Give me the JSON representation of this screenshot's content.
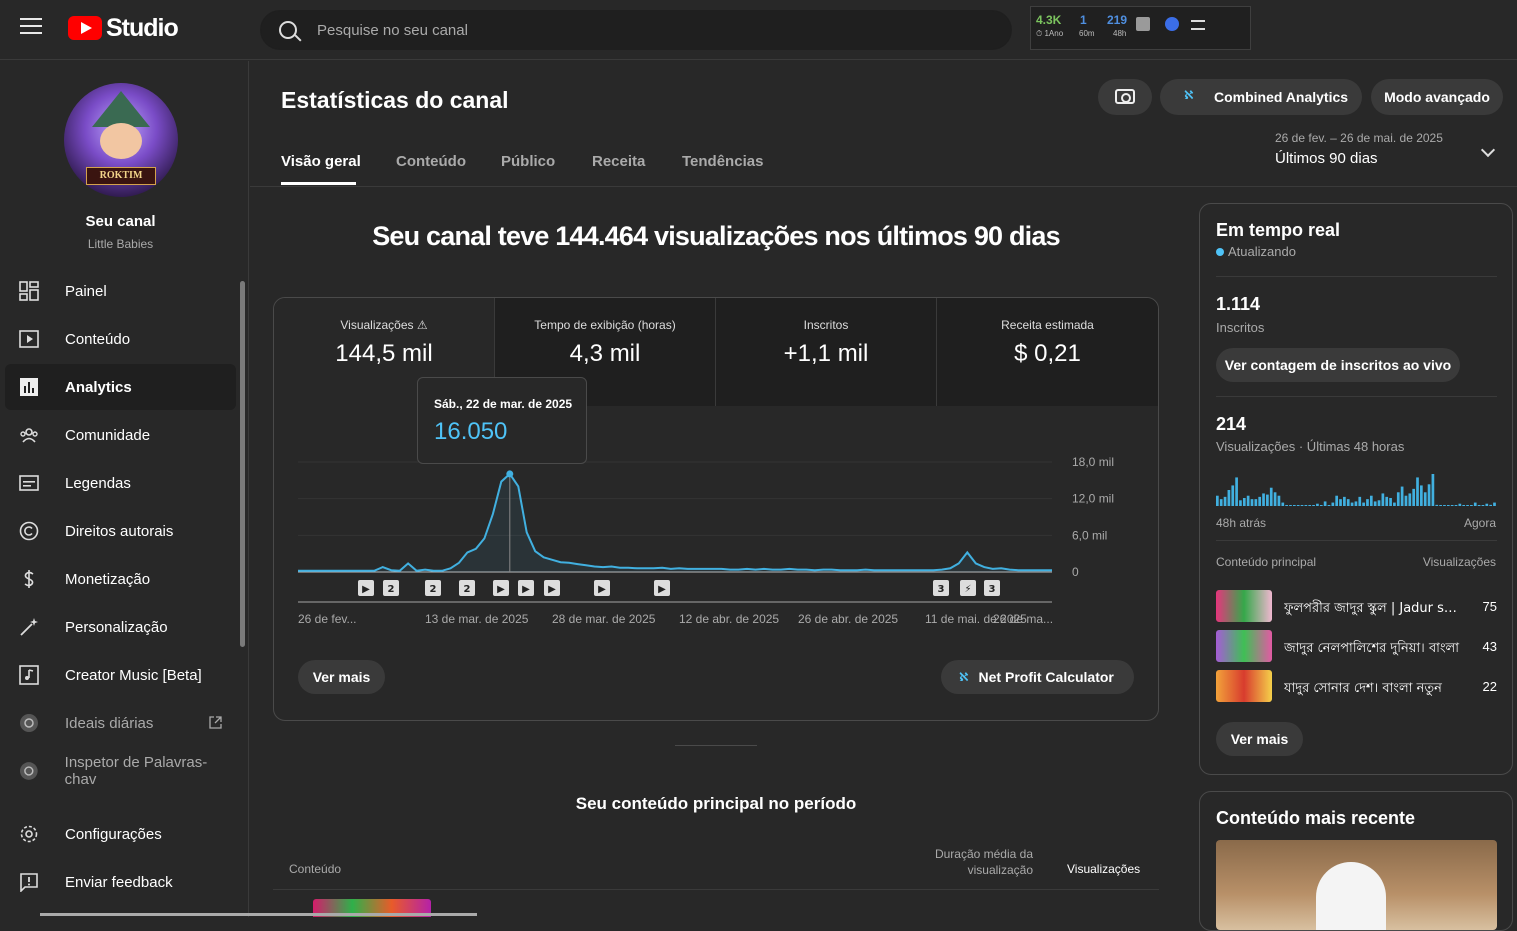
{
  "topbar": {
    "logo_text": "Studio",
    "search_placeholder": "Pesquise no seu canal",
    "ext_stats": [
      {
        "value": "4.3K",
        "sub": "⏱ 1Ano",
        "color": "#7cc45f"
      },
      {
        "value": "1",
        "sub": "60m",
        "color": "#4f8fe0"
      },
      {
        "value": "219",
        "sub": "48h",
        "color": "#4f8fe0"
      }
    ]
  },
  "sidebar": {
    "channel_banner": "ROKTIM",
    "channel_name": "Seu canal",
    "channel_sub": "Little Babies",
    "items": [
      {
        "label": "Painel",
        "icon": "dashboard-icon"
      },
      {
        "label": "Conteúdo",
        "icon": "content-icon"
      },
      {
        "label": "Analytics",
        "icon": "analytics-icon"
      },
      {
        "label": "Comunidade",
        "icon": "community-icon"
      },
      {
        "label": "Legendas",
        "icon": "subtitles-icon"
      },
      {
        "label": "Direitos autorais",
        "icon": "copyright-icon"
      },
      {
        "label": "Monetização",
        "icon": "dollar-icon"
      },
      {
        "label": "Personalização",
        "icon": "magic-wand-icon"
      },
      {
        "label": "Creator Music [Beta]",
        "icon": "music-icon"
      },
      {
        "label": "Ideais diárias",
        "icon": "vidiq-icon"
      },
      {
        "label": "Inspetor de Palavras-chav",
        "icon": "vidiq-icon"
      },
      {
        "label": "Configurações",
        "icon": "gear-icon"
      },
      {
        "label": "Enviar feedback",
        "icon": "feedback-icon"
      }
    ]
  },
  "header": {
    "title": "Estatísticas do canal",
    "combined_analytics": "Combined Analytics",
    "advanced_mode": "Modo avançado",
    "date_range": "26 de fev. – 26 de mai. de 2025",
    "date_label": "Últimos 90 dias",
    "tabs": [
      "Visão geral",
      "Conteúdo",
      "Público",
      "Receita",
      "Tendências"
    ]
  },
  "overview": {
    "headline": "Seu canal teve 144.464 visualizações nos últimos 90 dias",
    "metrics": [
      {
        "label": "Visualizações",
        "value": "144,5 mil"
      },
      {
        "label": "Tempo de exibição (horas)",
        "value": "4,3 mil"
      },
      {
        "label": "Inscritos",
        "value": "+1,1 mil"
      },
      {
        "label": "Receita estimada",
        "value": "$ 0,21"
      }
    ],
    "tooltip_date": "Sáb., 22 de mar. de 2025",
    "tooltip_value": "16.050",
    "see_more": "Ver mais",
    "net_profit": "Net Profit Calculator"
  },
  "chart_data": {
    "type": "line",
    "ylim": [
      0,
      18000
    ],
    "yticks": [
      0,
      6000,
      12000,
      18000
    ],
    "ytick_labels": [
      "0",
      "6,0 mil",
      "12,0 mil",
      "18,0 mil"
    ],
    "xtick_labels": [
      "26 de fev...",
      "13 de mar. de 2025",
      "28 de mar. de 2025",
      "12 de abr. de 2025",
      "26 de abr. de 2025",
      "11 de mai. de 2025",
      "26 de ma..."
    ],
    "x_days": 90,
    "values": [
      200,
      200,
      200,
      200,
      200,
      200,
      200,
      200,
      200,
      200,
      800,
      300,
      200,
      1400,
      200,
      400,
      200,
      200,
      600,
      1500,
      3200,
      3800,
      5500,
      9500,
      14800,
      16050,
      14000,
      6500,
      3400,
      2400,
      2000,
      1600,
      1500,
      1300,
      1100,
      900,
      800,
      900,
      700,
      700,
      600,
      600,
      600,
      700,
      500,
      600,
      500,
      500,
      500,
      500,
      500,
      400,
      400,
      500,
      400,
      500,
      400,
      400,
      500,
      400,
      400,
      300,
      400,
      400,
      300,
      300,
      300,
      400,
      300,
      300,
      300,
      300,
      300,
      300,
      300,
      300,
      400,
      600,
      1400,
      3200,
      1400,
      800,
      500,
      600,
      400,
      300,
      300,
      300,
      300,
      300
    ],
    "highlight_index": 25,
    "marker_labels": [
      "▶",
      "2",
      "2",
      "2",
      "▶",
      "▶",
      "▶",
      "▶",
      "▶",
      "3",
      "⚡",
      "3"
    ]
  },
  "top_content": {
    "title": "Seu conteúdo principal no período",
    "col_content": "Conteúdo",
    "col_duration": "Duração média da visualização",
    "col_views": "Visualizações"
  },
  "realtime": {
    "title": "Em tempo real",
    "updating": "Atualizando",
    "subs_value": "1.114",
    "subs_label": "Inscritos",
    "live_button": "Ver contagem de inscritos ao vivo",
    "views_value": "214",
    "views_label": "Visualizações · Últimas 48 horas",
    "ago": "48h atrás",
    "now": "Agora",
    "bars": [
      9,
      6,
      8,
      14,
      18,
      25,
      5,
      7,
      9,
      6,
      6,
      8,
      11,
      10,
      16,
      12,
      9,
      3,
      0,
      0,
      0,
      0,
      0,
      0,
      0,
      0,
      2,
      0,
      4,
      0,
      3,
      9,
      6,
      8,
      6,
      3,
      4,
      8,
      3,
      6,
      9,
      4,
      5,
      11,
      8,
      7,
      3,
      12,
      17,
      9,
      11,
      15,
      25,
      18,
      12,
      19,
      28,
      1,
      0,
      0,
      0,
      0,
      0,
      2,
      0,
      0,
      0,
      3,
      0,
      0,
      2,
      1,
      3
    ],
    "top_header": "Conteúdo principal",
    "top_views_header": "Visualizações",
    "rows": [
      {
        "title": "ফুলপরীর জাদুর স্কুল | Jadur school",
        "views": "75"
      },
      {
        "title": "জাদুর নেলপালিশের দুনিয়া। বাংলা",
        "views": "43"
      },
      {
        "title": "যাদুর সোনার দেশ। বাংলা নতুন",
        "views": "22"
      }
    ],
    "see_more": "Ver mais"
  },
  "recent": {
    "title": "Conteúdo mais recente"
  }
}
